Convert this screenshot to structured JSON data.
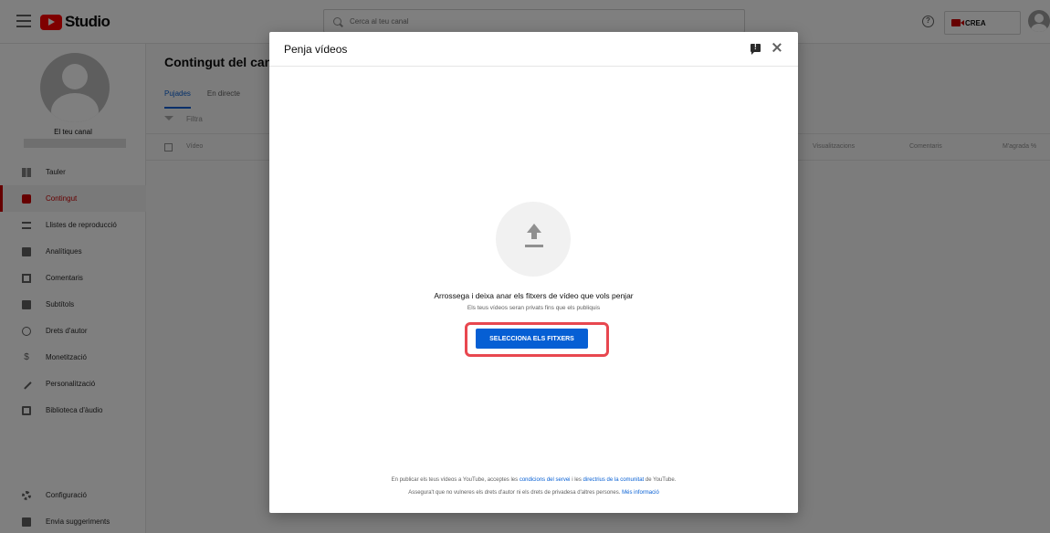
{
  "topbar": {
    "logo_text": "Studio",
    "search_placeholder": "Cerca al teu canal",
    "help_glyph": "?",
    "create_label": "CREA"
  },
  "sidebar": {
    "channel_label": "El teu canal",
    "items": [
      {
        "label": "Tauler",
        "icon": "dashboard-icon"
      },
      {
        "label": "Contingut",
        "icon": "content-icon",
        "active": true
      },
      {
        "label": "Llistes de reproducció",
        "icon": "playlist-icon"
      },
      {
        "label": "Analítiques",
        "icon": "analytics-icon"
      },
      {
        "label": "Comentaris",
        "icon": "comments-icon"
      },
      {
        "label": "Subtítols",
        "icon": "subtitles-icon"
      },
      {
        "label": "Drets d'autor",
        "icon": "copyright-icon"
      },
      {
        "label": "Monetització",
        "icon": "monetization-icon"
      },
      {
        "label": "Personalització",
        "icon": "customization-icon"
      },
      {
        "label": "Biblioteca d'àudio",
        "icon": "audio-library-icon"
      }
    ],
    "bottom_items": [
      {
        "label": "Configuració",
        "icon": "settings-icon"
      },
      {
        "label": "Envia suggeriments",
        "icon": "feedback-icon"
      }
    ]
  },
  "content": {
    "title": "Contingut del canal",
    "tabs": [
      "Pujades",
      "En directe"
    ],
    "filter_label": "Filtra",
    "columns": {
      "video": "Vídeo",
      "views": "Visualitzacions",
      "comments": "Comentaris",
      "likes": "M'agrada %"
    }
  },
  "dialog": {
    "title": "Penja vídeos",
    "drag_text": "Arrossega i deixa anar els fitxers de vídeo que vols penjar",
    "private_text": "Els teus vídeos seran privats fins que els publiquis",
    "select_button": "SELECCIONA ELS FITXERS",
    "legal": {
      "line1_prefix": "En publicar els teus vídeos a YouTube, acceptes les",
      "terms_link": "condicions del servei",
      "line1_mid": "i les",
      "guidelines_link": "directrius de la comunitat",
      "line1_suffix": "de YouTube.",
      "line2_prefix": "Assegura't que no vulneres els drets d'autor ni els drets de privadesa d'altres persones.",
      "more_link": "Més informació"
    }
  },
  "colors": {
    "brand_red": "#ff0000",
    "active_red": "#cc0000",
    "primary_blue": "#065fd4",
    "highlight_red": "#e8474f"
  }
}
